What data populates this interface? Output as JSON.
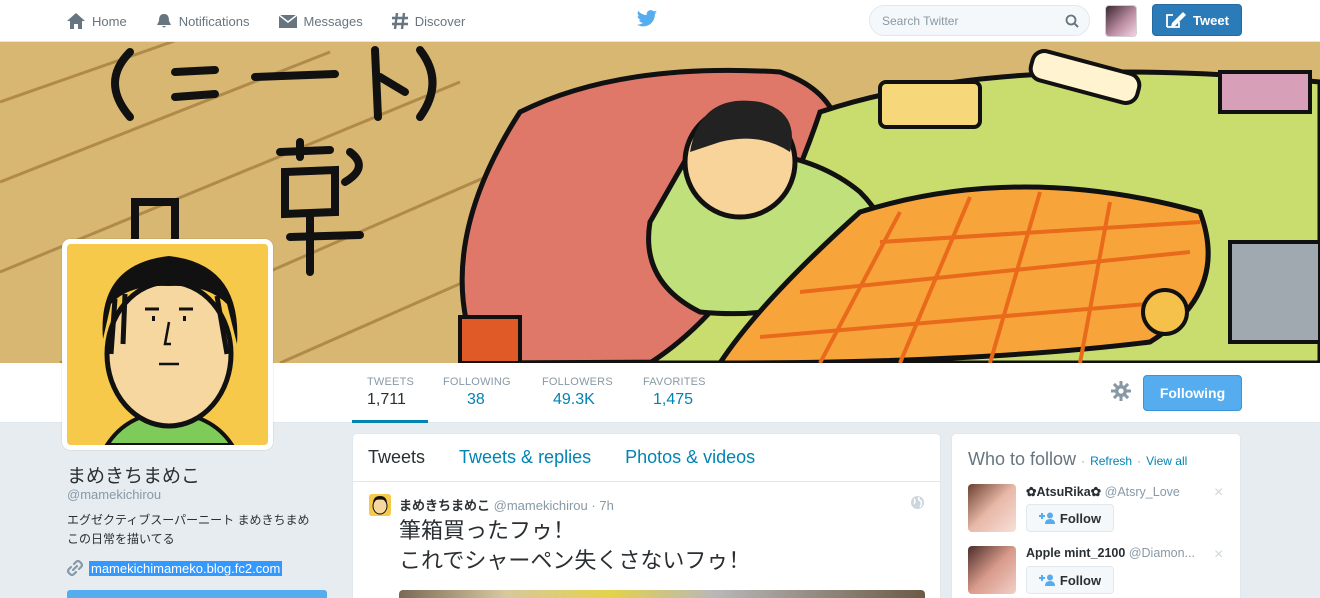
{
  "nav": {
    "items": [
      {
        "label": "Home",
        "icon": "home-icon"
      },
      {
        "label": "Notifications",
        "icon": "bell-icon"
      },
      {
        "label": "Messages",
        "icon": "envelope-icon"
      },
      {
        "label": "Discover",
        "icon": "hash-icon"
      }
    ],
    "search_placeholder": "Search Twitter",
    "tweet_label": "Tweet"
  },
  "profile": {
    "name": "まめきちまめこ",
    "handle": "@mamekichirou",
    "bio_line1": "エグゼクティブスーパーニート まめきちまめ",
    "bio_line2": "この日常を描いてる",
    "link": "mamekichimameko.blog.fc2.com",
    "banner_text": "(ニート) 日常"
  },
  "stats": [
    {
      "label": "TWEETS",
      "value": "1,711"
    },
    {
      "label": "FOLLOWING",
      "value": "38"
    },
    {
      "label": "FOLLOWERS",
      "value": "49.3K"
    },
    {
      "label": "FAVORITES",
      "value": "1,475"
    }
  ],
  "following_label": "Following",
  "tabs": [
    "Tweets",
    "Tweets & replies",
    "Photos & videos"
  ],
  "tweet": {
    "name": "まめきちまめこ",
    "handle": "@mamekichirou",
    "sep": "·",
    "time": "7h",
    "line1": "筆箱買ったフゥ！",
    "line2": "これでシャーペン失くさないフゥ！"
  },
  "who_to_follow": {
    "title": "Who to follow",
    "dot": "·",
    "refresh": "Refresh",
    "view_all": "View all",
    "follow_label": "Follow",
    "close": "×",
    "suggestions": [
      {
        "name": "✿AtsuRika✿",
        "handle": "@Atsry_Love"
      },
      {
        "name": "Apple mint_2100",
        "handle": "@Diamon..."
      }
    ]
  },
  "colors": {
    "accent": "#55acee",
    "link": "#0084b4",
    "banner_bg": "#d8b772"
  }
}
